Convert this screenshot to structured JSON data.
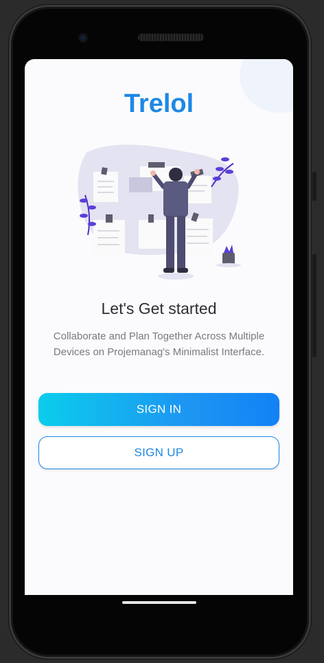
{
  "app": {
    "title": "Trelol"
  },
  "welcome": {
    "heading": "Let's Get started",
    "subtitle_line1": "Collaborate and Plan Together Across Multiple",
    "subtitle_line2": "Devices on Projemanag's Minimalist Interface."
  },
  "actions": {
    "sign_in_label": "SIGN IN",
    "sign_up_label": "SIGN UP"
  },
  "colors": {
    "brand": "#1e88e5",
    "gradient_start": "#0bcdec",
    "gradient_end": "#1282f6",
    "illustration_accent": "#5b3fd6"
  },
  "icons": {
    "illustration": "person-at-board-illustration"
  }
}
